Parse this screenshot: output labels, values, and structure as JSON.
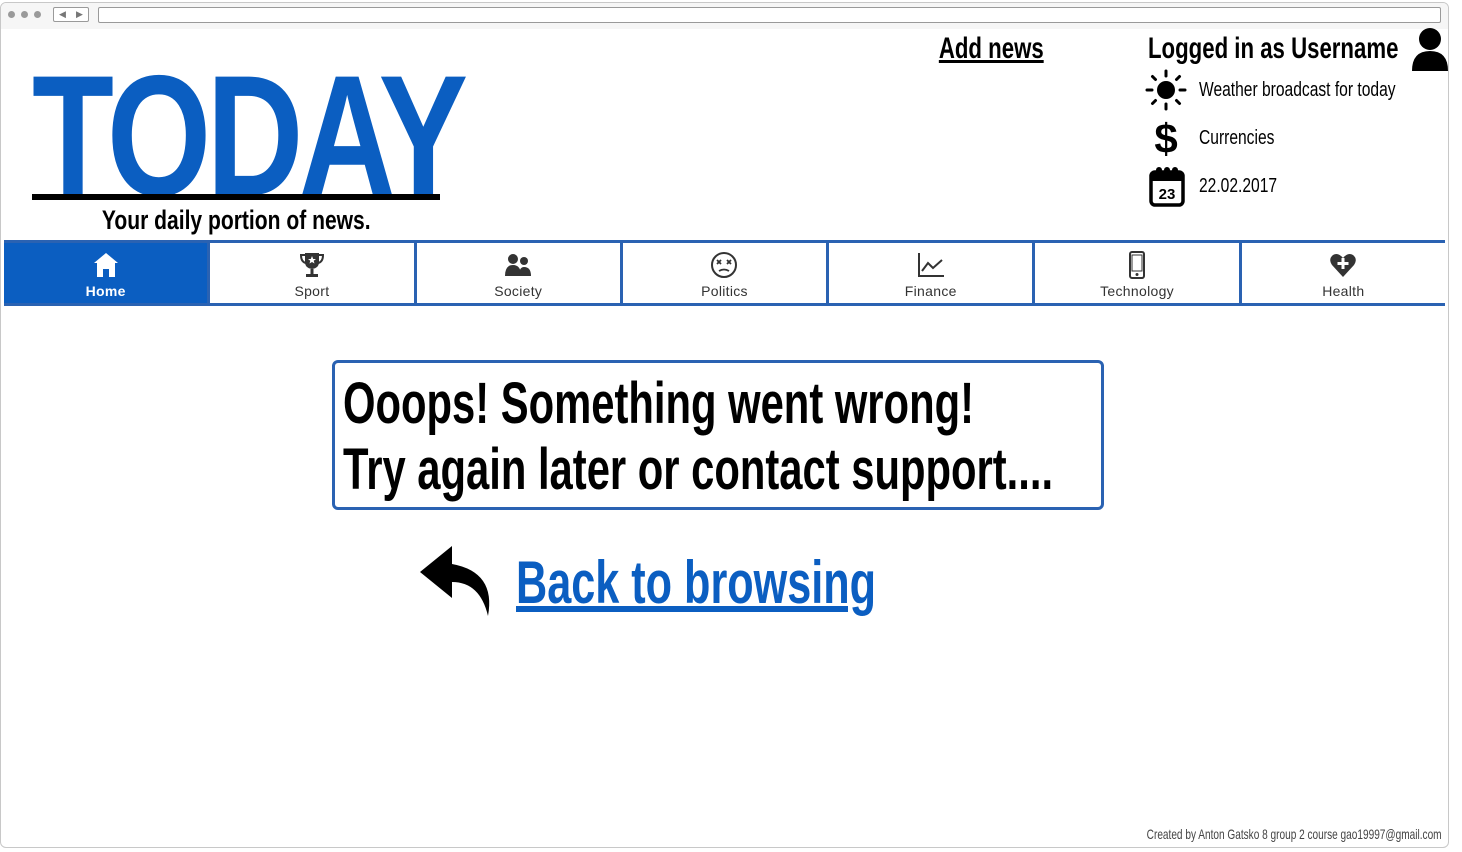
{
  "site": {
    "logo": "TODAY",
    "tagline": "Your daily portion of news."
  },
  "header": {
    "add_news": "Add news",
    "logged_in": "Logged in as Username",
    "user_icon": "user-icon",
    "info": {
      "weather": {
        "icon": "sun-icon",
        "label": "Weather broadcast for today"
      },
      "currencies": {
        "icon": "dollar-icon",
        "label": "Currencies"
      },
      "date": {
        "icon": "calendar-icon",
        "day": "23",
        "label": "22.02.2017"
      }
    }
  },
  "nav": {
    "items": [
      {
        "label": "Home",
        "icon": "home-icon",
        "active": true
      },
      {
        "label": "Sport",
        "icon": "trophy-icon"
      },
      {
        "label": "Society",
        "icon": "people-icon"
      },
      {
        "label": "Politics",
        "icon": "dizzy-face-icon"
      },
      {
        "label": "Finance",
        "icon": "line-chart-icon"
      },
      {
        "label": "Technology",
        "icon": "mobile-icon"
      },
      {
        "label": "Health",
        "icon": "heart-plus-icon"
      }
    ]
  },
  "error": {
    "line1": "Ooops! Something went wrong!",
    "line2": "Try again later or contact support...."
  },
  "back": {
    "label": "Back to browsing",
    "icon": "reply-arrow-icon"
  },
  "footer": {
    "credit": "Created by Anton Gatsko 8 group 2 course gao19997@gmail.com"
  },
  "colors": {
    "brand": "#0b5ec1",
    "nav_border": "#2a62b2"
  }
}
